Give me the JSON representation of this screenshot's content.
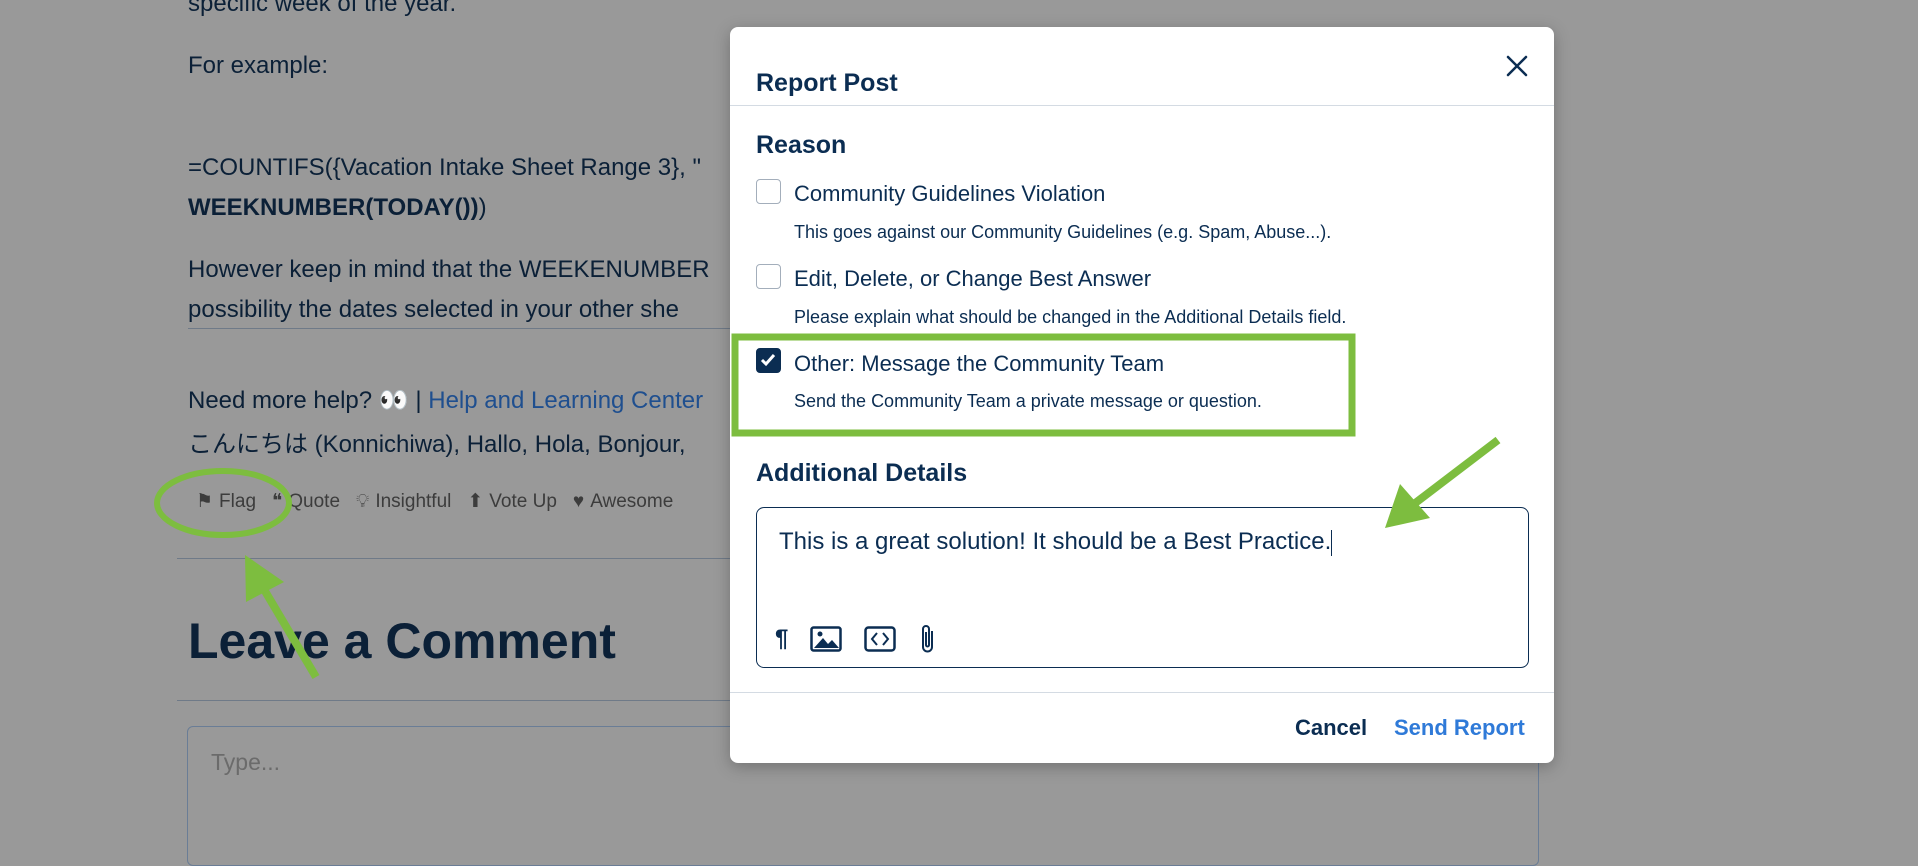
{
  "post": {
    "line_top": "specific week of the year.",
    "for_example": "For example:",
    "formula_line1": "=COUNTIFS({Vacation Intake Sheet Range 3}, \"",
    "formula_line2_bold": "WEEKNUMBER(TODAY())",
    "formula_line2_end": ")",
    "however_line1": "However keep in mind that the WEEKENUMBER",
    "however_line2": "possibility the dates selected in your other she",
    "help_prefix": "Need more help? 👀 | ",
    "help_link": "Help and Learning Center",
    "greeting": "こんにちは (Konnichiwa), Hallo, Hola, Bonjour,",
    "actions": [
      {
        "label": "Flag",
        "icon": "flag-icon"
      },
      {
        "label": "Quote",
        "icon": "quote-icon"
      },
      {
        "label": "Insightful",
        "icon": "lightbulb-icon"
      },
      {
        "label": "Vote Up",
        "icon": "arrow-up-icon"
      },
      {
        "label": "Awesome",
        "icon": "heart-icon"
      }
    ]
  },
  "comment": {
    "heading": "Leave a Comment",
    "placeholder": "Type..."
  },
  "modal": {
    "title": "Report Post",
    "reason_heading": "Reason",
    "reasons": [
      {
        "label": "Community Guidelines Violation",
        "description": "This goes against our Community Guidelines (e.g. Spam, Abuse...).",
        "checked": false
      },
      {
        "label": "Edit, Delete, or Change Best Answer",
        "description": "Please explain what should be changed in the Additional Details field.",
        "checked": false
      },
      {
        "label": "Other: Message the Community Team",
        "description": "Send the Community Team a private message or question.",
        "checked": true
      }
    ],
    "details_heading": "Additional Details",
    "details_value": "This is a great solution! It should be a Best Practice.",
    "toolbar": [
      "paragraph-icon",
      "image-icon",
      "code-icon",
      "paperclip-icon"
    ],
    "cancel": "Cancel",
    "send": "Send Report"
  },
  "colors": {
    "overlay": "#999999",
    "navy": "#0b2d52",
    "link": "#2f7ad8",
    "annotation": "#7dbd3f"
  }
}
